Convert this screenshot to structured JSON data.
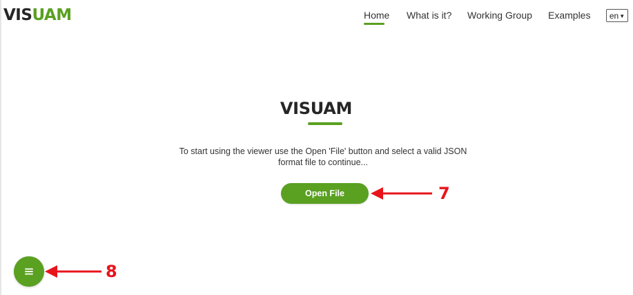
{
  "header": {
    "logo": {
      "part1": "VIS",
      "part2": "UAM"
    },
    "nav": [
      {
        "label": "Home",
        "active": true
      },
      {
        "label": "What is it?",
        "active": false
      },
      {
        "label": "Working Group",
        "active": false
      },
      {
        "label": "Examples",
        "active": false
      }
    ],
    "language": {
      "selected": "en",
      "icon": "chevron-down-icon"
    }
  },
  "main": {
    "title": "VISUAM",
    "description": "To start using the viewer use the Open 'File' button and select a valid JSON format file to continue...",
    "open_button_label": "Open File"
  },
  "fab": {
    "icon": "menu-icon"
  },
  "annotations": [
    {
      "number": "7",
      "target": "open-file-button"
    },
    {
      "number": "8",
      "target": "menu-fab-button"
    }
  ],
  "colors": {
    "accent": "#5aa021",
    "logo_dark": "#262626",
    "annotation_red": "#e8141b"
  }
}
